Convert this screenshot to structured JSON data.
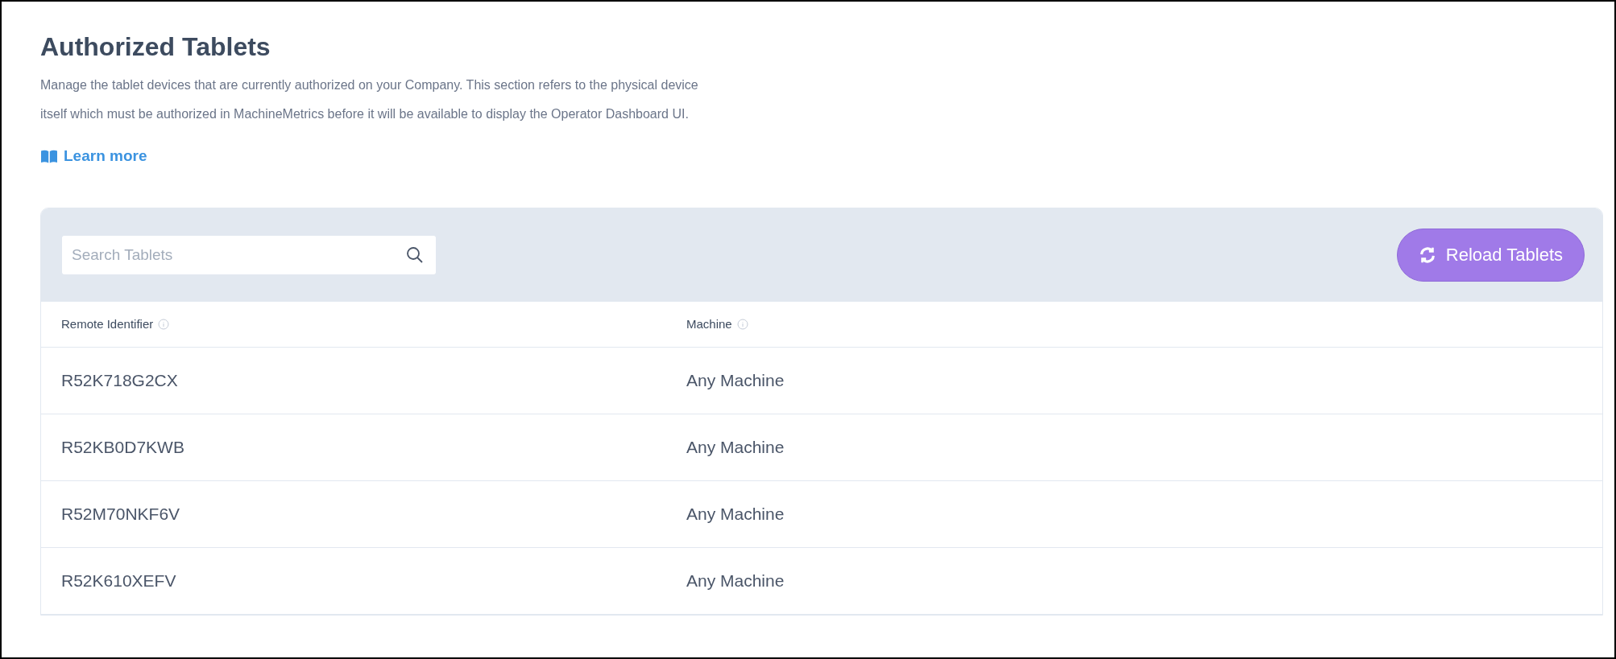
{
  "page": {
    "title": "Authorized Tablets",
    "description": "Manage the tablet devices that are currently authorized on your Company. This section refers to the physical device itself which must be authorized in MachineMetrics before it will be available to display the Operator Dashboard UI.",
    "learn_more": "Learn more"
  },
  "toolbar": {
    "search": {
      "placeholder": "Search Tablets"
    },
    "reload_button": "Reload Tablets"
  },
  "table": {
    "columns": [
      "Remote Identifier",
      "Machine"
    ],
    "rows": [
      [
        "R52K718G2CX",
        "Any Machine"
      ],
      [
        "R52KB0D7KWB",
        "Any Machine"
      ],
      [
        "R52M70NKF6V",
        "Any Machine"
      ],
      [
        "R52K610XEFV",
        "Any Machine"
      ]
    ]
  }
}
